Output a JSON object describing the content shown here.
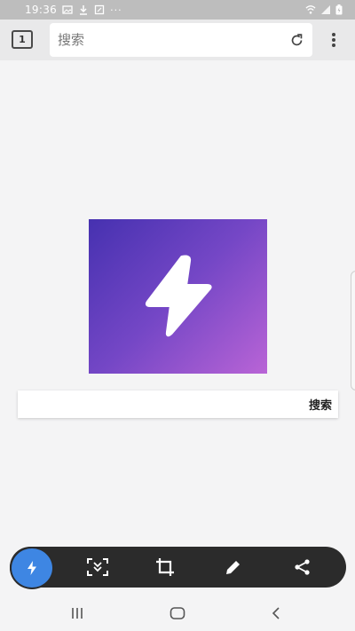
{
  "status_bar": {
    "time": "19:36",
    "overflow": "···",
    "icons": [
      "image-icon",
      "download-icon",
      "screenshot-icon",
      "wifi-icon",
      "signal-icon",
      "battery-icon"
    ]
  },
  "toolbar": {
    "tab_count": "1",
    "address_placeholder": "搜索",
    "icons": [
      "reload-icon",
      "more-vert-icon"
    ]
  },
  "content": {
    "logo_icon": "lightning-bolt-icon",
    "logo_gradient": [
      "#4631b0",
      "#7547c6",
      "#b964d6"
    ],
    "search_button_label": "搜索",
    "search_placeholder": ""
  },
  "capture_bar": {
    "icons": [
      "flash-icon",
      "scroll-capture-icon",
      "crop-icon",
      "edit-icon",
      "share-icon"
    ],
    "accent_color": "#3e86e3"
  },
  "nav_bar": {
    "icons": [
      "recent-apps-icon",
      "home-icon",
      "back-icon"
    ]
  }
}
